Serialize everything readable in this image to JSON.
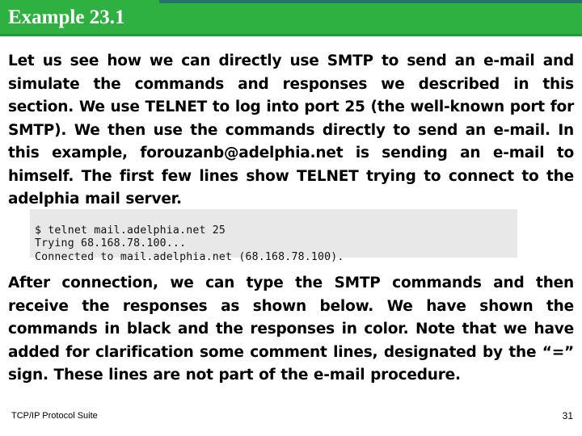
{
  "header": {
    "title": "Example 23.1",
    "bar_color": "#2eb140",
    "accent_color": "#23756c",
    "title_color": "#ffffff"
  },
  "body": {
    "paragraph_1": "Let us see how we can directly use SMTP to send an e-mail and simulate the commands and responses we described in this section. We use TELNET to log into port 25 (the well-known port for SMTP). We then use the commands directly to send an e-mail. In this example, forouzanb@adelphia.net is sending an e-mail to himself. The first few lines show TELNET trying to connect to the adelphia mail server.",
    "paragraph_2": "After connection, we can type the SMTP commands and then receive the responses as shown below. We have shown the commands in black and the responses in color. Note that we have added for clarification some comment lines, designated by the “=” sign. These lines are not part of the e-mail procedure."
  },
  "code_block": {
    "background_color": "#e8e8e8",
    "lines": [
      "$ telnet mail.adelphia.net 25",
      "Trying 68.168.78.100...",
      "Connected to mail.adelphia.net (68.168.78.100)."
    ],
    "text": "$ telnet mail.adelphia.net 25\nTrying 68.168.78.100...\nConnected to mail.adelphia.net (68.168.78.100)."
  },
  "footer": {
    "left_label": "TCP/IP Protocol Suite",
    "page_number": "31"
  }
}
